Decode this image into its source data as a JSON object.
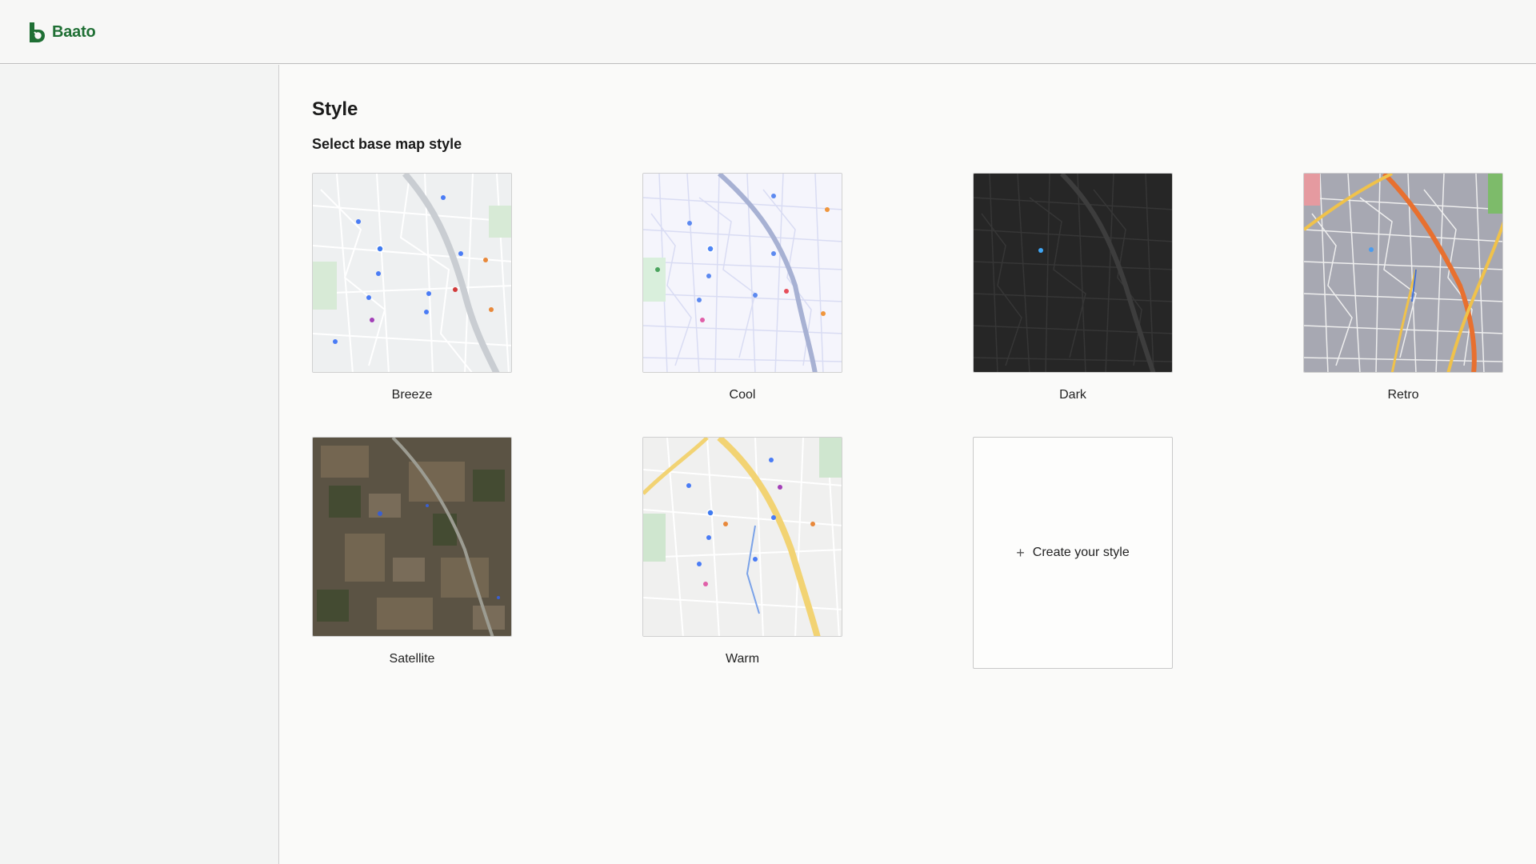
{
  "app": {
    "brand_name": "Baato",
    "brand_color": "#1f6f34"
  },
  "page": {
    "title": "Style",
    "subtitle": "Select base map style"
  },
  "styles": [
    {
      "label": "Breeze",
      "theme": "light-gray"
    },
    {
      "label": "Cool",
      "theme": "lavender"
    },
    {
      "label": "Dark",
      "theme": "dark"
    },
    {
      "label": "Retro",
      "theme": "retro"
    },
    {
      "label": "Satellite",
      "theme": "satellite"
    },
    {
      "label": "Warm",
      "theme": "warm"
    }
  ],
  "create": {
    "label": "Create your style",
    "icon": "plus-icon"
  }
}
